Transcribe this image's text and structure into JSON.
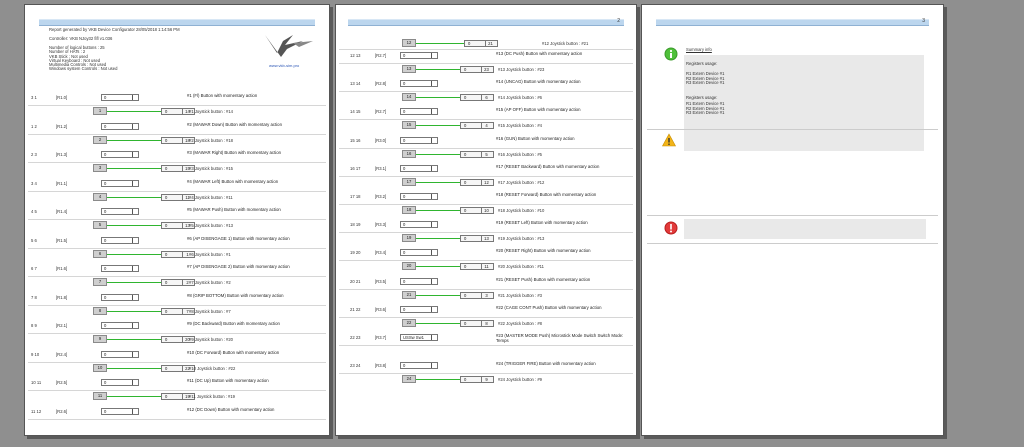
{
  "page1": {
    "header": [
      "Report generated by VKB Device Configurator   28/05/2018   1:14:56 PM",
      "Controller: VKB NJoy32 fifl  v1.036",
      "Number of logical buttons : 25",
      "Number of HATs : 2",
      "VKB Stick : Not used",
      "Virtual Keyboard : Not used",
      "Multimedia Controls : Not used",
      "Windows system Controls : Not used"
    ],
    "logo_url": "www.vkb-sim.pro",
    "rows": [
      {
        "num": "3    1",
        "reg": "[R1.0]",
        "val": "0",
        "desc": "#1 (Fl)  Button with momentary action",
        "btn": "1",
        "lval": "0",
        "lid": "14",
        "joy": "#1 Joystick button : #14"
      },
      {
        "num": "1    2",
        "reg": "[R1.2]",
        "val": "0",
        "desc": "#2 (MAWAR Down)  Button with momentary action",
        "btn": "2",
        "lval": "0",
        "lid": "18",
        "joy": "#2 Joystick button : #18"
      },
      {
        "num": "2    3",
        "reg": "[R1.3]",
        "val": "0",
        "desc": "#3 (MAWAR Right)  Button with momentary action",
        "btn": "3",
        "lval": "0",
        "lid": "15",
        "joy": "#3 Joystick button : #15"
      },
      {
        "num": "3    4",
        "reg": "[R1.1]",
        "val": "0",
        "desc": "#4 (MAWAR Left)  Button with momentary action",
        "btn": "4",
        "lval": "0",
        "lid": "11",
        "joy": "#4 Joystick button : #11"
      },
      {
        "num": "4    5",
        "reg": "[R1.4]",
        "val": "0",
        "desc": "#5 (MAWAR Push)  Button with momentary action",
        "btn": "5",
        "lval": "0",
        "lid": "13",
        "joy": "#5 Joystick button : #13"
      },
      {
        "num": "5    6",
        "reg": "[R1.5]",
        "val": "0",
        "desc": "#6 (AP DISENGAGE 1)  Button with momentary action",
        "btn": "6",
        "lval": "0",
        "lid": "1",
        "joy": "#6 Joystick button : #1"
      },
      {
        "num": "6    7",
        "reg": "[R1.6]",
        "val": "0",
        "desc": "#7 (AP DISENGAGE 2)  Button with momentary action",
        "btn": "7",
        "lval": "0",
        "lid": "2",
        "joy": "#7 Joystick button : #2"
      },
      {
        "num": "7    8",
        "reg": "[R1.8]",
        "val": "0",
        "desc": "#8 (GRIP BOTTOM)  Button with momentary action",
        "btn": "8",
        "lval": "0",
        "lid": "7",
        "joy": "#8 Joystick button : #7"
      },
      {
        "num": "8    9",
        "reg": "[R2.1]",
        "val": "0",
        "desc": "#9 (DC Backward)  Button with momentary action",
        "btn": "9",
        "lval": "0",
        "lid": "20",
        "joy": "#9 Joystick button : #20"
      },
      {
        "num": "9   10",
        "reg": "[R2.4]",
        "val": "0",
        "desc": "#10 (DC Forward)  Button with momentary action",
        "btn": "10",
        "lval": "0",
        "lid": "22",
        "joy": "#10 Joystick button : #22"
      },
      {
        "num": "10  11",
        "reg": "[R2.5]",
        "val": "0",
        "desc": "#11 (DC Up)  Button with momentary action",
        "btn": "11",
        "lval": "0",
        "lid": "19",
        "joy": "#11 Joystick button : #19"
      },
      {
        "num": "11  12",
        "reg": "[R2.6]",
        "val": "0",
        "desc": "#12 (DC Down)  Button with momentary action",
        "btn": "",
        "lval": "",
        "lid": "",
        "joy": ""
      }
    ]
  },
  "page2": {
    "page_no": "2",
    "top": {
      "btn": "12",
      "lval": "0",
      "lid": "21",
      "joy": "#12 Joystick button : #21"
    },
    "rows": [
      {
        "num": "12  13",
        "reg": "[R2.7]",
        "val": "0",
        "desc": "#13 (DC Push)  Button with momentary action",
        "btn": "13",
        "lval": "0",
        "lid": "23",
        "joy": "#13 Joystick button : #23"
      },
      {
        "num": "13  14",
        "reg": "[R2.8]",
        "val": "0",
        "desc": "#14 (UNCAG)  Button with momentary action",
        "btn": "14",
        "lval": "0",
        "lid": "6",
        "joy": "#14 Joystick button : #6"
      },
      {
        "num": "14  15",
        "reg": "[R2.7]",
        "val": "0",
        "desc": "#15 (AP OFF)  Button with momentary action",
        "btn": "15",
        "lval": "0",
        "lid": "4",
        "joy": "#15 Joystick button : #4"
      },
      {
        "num": "15  16",
        "reg": "[R3.0]",
        "val": "0",
        "desc": "#16 (GUN)  Button with momentary action",
        "btn": "16",
        "lval": "0",
        "lid": "5",
        "joy": "#16 Joystick button : #5"
      },
      {
        "num": "16  17",
        "reg": "[R3.1]",
        "val": "0",
        "desc": "#17 (RESET Backward)  Button with momentary action",
        "btn": "17",
        "lval": "0",
        "lid": "12",
        "joy": "#17 Joystick button : #12"
      },
      {
        "num": "17  18",
        "reg": "[R3.2]",
        "val": "0",
        "desc": "#18 (RESET Forward)  Button with momentary action",
        "btn": "18",
        "lval": "0",
        "lid": "10",
        "joy": "#18 Joystick button : #10"
      },
      {
        "num": "18  19",
        "reg": "[R3.3]",
        "val": "0",
        "desc": "#19 (RESET Left)  Button with momentary action",
        "btn": "19",
        "lval": "0",
        "lid": "13",
        "joy": "#19 Joystick button : #13"
      },
      {
        "num": "19  20",
        "reg": "[R3.4]",
        "val": "0",
        "desc": "#20 (RESET Right)  Button with momentary action",
        "btn": "20",
        "lval": "0",
        "lid": "11",
        "joy": "#20 Joystick button : #11"
      },
      {
        "num": "20  21",
        "reg": "[R3.5]",
        "val": "0",
        "desc": "#21 (RESET Push)  Button with momentary action",
        "btn": "21",
        "lval": "0",
        "lid": "3",
        "joy": "#21 Joystick button : #3"
      },
      {
        "num": "21  22",
        "reg": "[R3.6]",
        "val": "0",
        "desc": "#22 (CAGE CONT Push)  Button with momentary action",
        "btn": "22",
        "lval": "0",
        "lid": "8",
        "joy": "#22 Joystick button : #8"
      },
      {
        "num": "22  23",
        "reg": "[R3.7]",
        "val": "USSw  Sw1",
        "desc": "#23 (MASTER MODE Push) Microstick Mode Switch  Switch Mode: Temps",
        "btn": "",
        "lval": "",
        "lid": "",
        "joy": ""
      },
      {
        "num": "23  24",
        "reg": "[R3.8]",
        "val": "0",
        "desc": "#24 (TRIGGER FIRE)  Button with momentary action",
        "btn": "24",
        "lval": "0",
        "lid": "9",
        "joy": "#24 Joystick button : #9"
      }
    ]
  },
  "page3": {
    "page_no": "3",
    "summary_title": "Summary info",
    "registers_used": "Registers usage:",
    "lines_a": [
      "R1      Extern Device #1",
      "R2      Extern Device #1",
      "R3      Extern Device #1"
    ],
    "registers_used_2": "Registers usage:",
    "lines_b": [
      "R1      Extern Device #1",
      "R2      Extern Device #1",
      "R3      Extern Device #1"
    ]
  }
}
